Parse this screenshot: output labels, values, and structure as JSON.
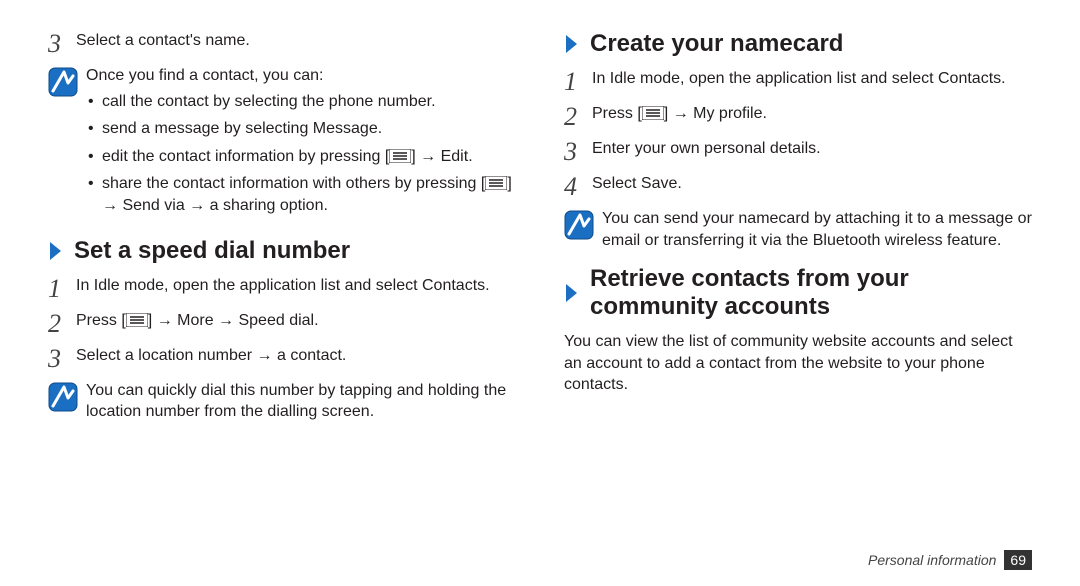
{
  "left": {
    "step3": {
      "num": "3",
      "text": "Select a contact's name."
    },
    "note1": {
      "intro": "Once you find a contact, you can:",
      "bullets": [
        {
          "pre": "call the contact by selecting the phone number."
        },
        {
          "pre": "send a message by selecting ",
          "lit": "Message",
          "post": "."
        },
        {
          "pre": "edit the contact information by pressing [",
          "post": "] → ",
          "lit2": "Edit",
          "post2": "."
        },
        {
          "pre": "share the contact information with others by pressing [",
          "post": "] → ",
          "lit2": "Send via",
          "post2": " → a sharing option."
        }
      ]
    },
    "heading1": "Set a speed dial number",
    "s1": {
      "num": "1",
      "pre": "In Idle mode, open the application list and select ",
      "lit": "Contacts",
      "post": "."
    },
    "s2": {
      "num": "2",
      "pre": "Press [",
      "mid": "] → ",
      "lit1": "More",
      "arrow": " → ",
      "lit2": "Speed dial",
      "post": "."
    },
    "s3": {
      "num": "3",
      "text": "Select a location number → a contact."
    },
    "note2": "You can quickly dial this number by tapping and holding the location number from the dialling screen."
  },
  "right": {
    "heading1": "Create your namecard",
    "s1": {
      "num": "1",
      "pre": "In Idle mode, open the application list and select ",
      "lit": "Contacts",
      "post": "."
    },
    "s2": {
      "num": "2",
      "pre": "Press [",
      "mid": "] → ",
      "lit": "My profile",
      "post": "."
    },
    "s3": {
      "num": "3",
      "text": "Enter your own personal details."
    },
    "s4": {
      "num": "4",
      "pre": "Select ",
      "lit": "Save",
      "post": "."
    },
    "note1": "You can send your namecard by attaching it to a message or email or transferring it via the Bluetooth wireless feature.",
    "heading2": "Retrieve contacts from your community accounts",
    "para1": "You can view the list of community website accounts and select an account to add a contact from the website to your phone contacts."
  },
  "footer": {
    "section": "Personal information",
    "page": "69"
  }
}
